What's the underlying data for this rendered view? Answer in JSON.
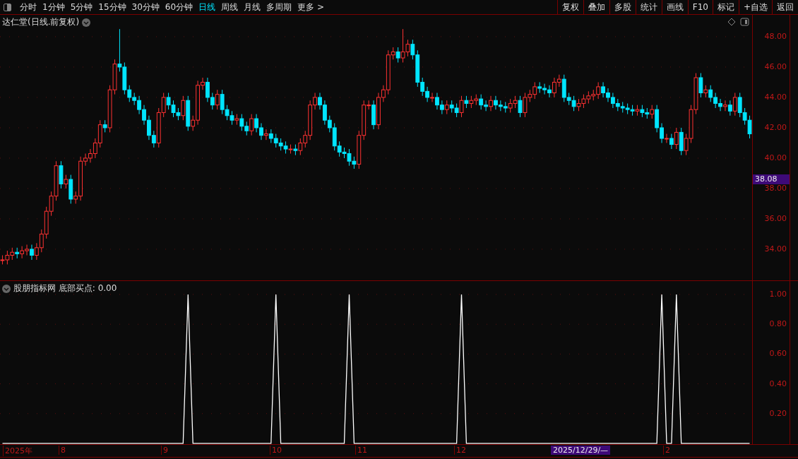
{
  "toolbar": {
    "period_tabs": [
      {
        "label": "分时",
        "selected": false
      },
      {
        "label": "1分钟",
        "selected": false
      },
      {
        "label": "5分钟",
        "selected": false
      },
      {
        "label": "15分钟",
        "selected": false
      },
      {
        "label": "30分钟",
        "selected": false
      },
      {
        "label": "60分钟",
        "selected": false
      },
      {
        "label": "日线",
        "selected": true
      },
      {
        "label": "周线",
        "selected": false
      },
      {
        "label": "月线",
        "selected": false
      },
      {
        "label": "多周期",
        "selected": false
      },
      {
        "label": "更多 >",
        "selected": false
      }
    ],
    "buttons": [
      "复权",
      "叠加",
      "多股",
      "统计",
      "画线",
      "F10",
      "标记",
      "+自选",
      "返回"
    ]
  },
  "main_chart": {
    "title": "达仁堂(日线.前复权)",
    "cursor_price": "38.08",
    "chart_data": {
      "type": "candlestick",
      "grid": true,
      "ylim": [
        31.95,
        49.44
      ],
      "yticks": [
        {
          "value": 48,
          "label": "48.00"
        },
        {
          "value": 46,
          "label": "46.00"
        },
        {
          "value": 44,
          "label": "44.00"
        },
        {
          "value": 42,
          "label": "42.00"
        },
        {
          "value": 40,
          "label": "40.00"
        },
        {
          "value": 38,
          "label": "38.00"
        },
        {
          "value": 36,
          "label": "36.00"
        },
        {
          "value": 34,
          "label": "34.00"
        }
      ],
      "ohlc": [
        [
          33.3,
          33.6,
          33.0,
          33.3
        ],
        [
          33.3,
          33.9,
          33.0,
          33.6
        ],
        [
          33.6,
          34.1,
          33.3,
          33.8
        ],
        [
          33.8,
          34.1,
          33.4,
          33.7
        ],
        [
          33.7,
          34.2,
          33.4,
          33.9
        ],
        [
          33.9,
          34.3,
          33.6,
          34.0
        ],
        [
          34.0,
          34.3,
          33.3,
          33.6
        ],
        [
          33.6,
          34.4,
          33.3,
          34.1
        ],
        [
          34.1,
          35.3,
          33.8,
          35
        ],
        [
          35,
          36.8,
          34.7,
          36.5
        ],
        [
          36.5,
          37.8,
          36.2,
          37.5
        ],
        [
          37.5,
          39.8,
          37.2,
          39.5
        ],
        [
          39.5,
          39.8,
          38.0,
          38.3
        ],
        [
          38.3,
          38.9,
          38.0,
          38.6
        ],
        [
          38.6,
          38.9,
          37.0,
          37.3
        ],
        [
          37.3,
          37.8,
          37.0,
          37.5
        ],
        [
          37.5,
          40.1,
          37.2,
          39.8
        ],
        [
          39.8,
          40.3,
          39.5,
          40
        ],
        [
          40,
          40.6,
          39.7,
          40.3
        ],
        [
          40.3,
          41.3,
          40.0,
          41
        ],
        [
          41,
          42.5,
          40.7,
          42.2
        ],
        [
          42.2,
          42.5,
          41.7,
          42
        ],
        [
          42,
          44.8,
          41.7,
          44.5
        ],
        [
          44.5,
          46.5,
          44.2,
          46.2
        ],
        [
          46.2,
          48.5,
          45.7,
          46
        ],
        [
          46,
          46.3,
          44.2,
          44.5
        ],
        [
          44.5,
          44.8,
          43.7,
          44
        ],
        [
          44,
          44.3,
          43.5,
          43.8
        ],
        [
          43.8,
          44.1,
          42.9,
          43.2
        ],
        [
          43.2,
          43.5,
          42.2,
          42.5
        ],
        [
          42.5,
          42.8,
          41.2,
          41.5
        ],
        [
          41.5,
          41.8,
          40.7,
          41
        ],
        [
          41,
          43.3,
          40.7,
          43
        ],
        [
          43,
          44.3,
          42.7,
          44
        ],
        [
          44,
          44.3,
          43.2,
          43.5
        ],
        [
          43.5,
          43.8,
          42.7,
          43
        ],
        [
          43,
          43.3,
          42.5,
          42.8
        ],
        [
          42.8,
          44.1,
          42.5,
          43.8
        ],
        [
          43.8,
          44.1,
          41.8,
          42.1
        ],
        [
          42.1,
          42.8,
          41.8,
          42.5
        ],
        [
          42.5,
          45.1,
          42.2,
          44.8
        ],
        [
          44.8,
          45.3,
          44.5,
          45
        ],
        [
          45,
          45.3,
          43.7,
          44
        ],
        [
          44,
          44.3,
          43.2,
          43.5
        ],
        [
          43.5,
          44.5,
          43.2,
          44.2
        ],
        [
          44.2,
          44.5,
          42.9,
          43.2
        ],
        [
          43.2,
          43.5,
          42.5,
          42.8
        ],
        [
          42.8,
          43.1,
          42.2,
          42.5
        ],
        [
          42.5,
          42.9,
          42.2,
          42.6
        ],
        [
          42.6,
          42.9,
          41.8,
          42.1
        ],
        [
          42.1,
          42.4,
          41.5,
          41.8
        ],
        [
          41.8,
          42.9,
          41.5,
          42.6
        ],
        [
          42.6,
          42.9,
          41.7,
          42
        ],
        [
          42,
          42.3,
          41.2,
          41.5
        ],
        [
          41.5,
          41.9,
          41.2,
          41.6
        ],
        [
          41.6,
          41.9,
          41.0,
          41.3
        ],
        [
          41.3,
          41.6,
          40.7,
          41
        ],
        [
          41,
          41.3,
          40.5,
          40.8
        ],
        [
          40.8,
          41.1,
          40.3,
          40.6
        ],
        [
          40.6,
          40.9,
          40.3,
          40.6
        ],
        [
          40.6,
          40.9,
          40.2,
          40.5
        ],
        [
          40.5,
          41.3,
          40.2,
          41
        ],
        [
          41,
          41.8,
          40.7,
          41.5
        ],
        [
          41.5,
          43.8,
          41.2,
          43.5
        ],
        [
          43.5,
          44.3,
          43.2,
          44
        ],
        [
          44,
          44.3,
          43.2,
          43.5
        ],
        [
          43.5,
          43.8,
          42.2,
          42.5
        ],
        [
          42.5,
          42.8,
          41.7,
          42.0
        ],
        [
          42,
          42.3,
          40.5,
          40.8
        ],
        [
          40.8,
          41.1,
          40.1,
          40.4
        ],
        [
          40.4,
          40.7,
          40.0,
          40.3
        ],
        [
          40.3,
          40.6,
          39.5,
          39.8
        ],
        [
          39.8,
          40.1,
          39.3,
          39.6
        ],
        [
          39.6,
          41.8,
          39.3,
          41.5
        ],
        [
          41.5,
          43.8,
          41.2,
          43.5
        ],
        [
          43.5,
          43.8,
          43.2,
          43.5
        ],
        [
          43.5,
          43.8,
          41.9,
          42.2
        ],
        [
          42.2,
          44.3,
          41.9,
          44
        ],
        [
          44,
          44.8,
          43.7,
          44.5
        ],
        [
          44.5,
          47.1,
          44.2,
          46.8
        ],
        [
          46.8,
          47.3,
          46.5,
          47
        ],
        [
          47,
          47.3,
          46.3,
          46.6
        ],
        [
          46.6,
          48.5,
          46.3,
          47
        ],
        [
          47,
          47.8,
          46.7,
          47.5
        ],
        [
          47.5,
          47.8,
          46.5,
          46.8
        ],
        [
          46.8,
          47.1,
          44.7,
          45
        ],
        [
          45,
          45.3,
          44.1,
          44.4
        ],
        [
          44.4,
          44.7,
          43.7,
          44
        ],
        [
          44,
          44.3,
          43.7,
          44
        ],
        [
          44,
          44.3,
          43.2,
          43.5
        ],
        [
          43.5,
          43.8,
          42.9,
          43.2
        ],
        [
          43.2,
          43.8,
          42.9,
          43.5
        ],
        [
          43.5,
          43.8,
          43.0,
          43.3
        ],
        [
          43.3,
          43.6,
          42.7,
          43.0
        ],
        [
          43.0,
          44.1,
          42.7,
          43.8
        ],
        [
          43.8,
          44.1,
          43.3,
          43.6
        ],
        [
          43.6,
          44.1,
          43.3,
          43.8
        ],
        [
          43.8,
          44.2,
          43.5,
          43.9
        ],
        [
          43.9,
          44.2,
          43.2,
          43.5
        ],
        [
          43.5,
          43.8,
          43.1,
          43.4
        ],
        [
          43.4,
          44.1,
          43.1,
          43.8
        ],
        [
          43.8,
          44.1,
          43.2,
          43.5
        ],
        [
          43.5,
          43.8,
          43.1,
          43.4
        ],
        [
          43.4,
          43.7,
          43.0,
          43.3
        ],
        [
          43.3,
          43.9,
          43.0,
          43.6
        ],
        [
          43.6,
          44.1,
          43.3,
          43.8
        ],
        [
          43.8,
          44.1,
          42.7,
          43
        ],
        [
          43,
          44.3,
          42.7,
          44
        ],
        [
          44,
          44.5,
          43.7,
          44.2
        ],
        [
          44.2,
          45.0,
          43.9,
          44.7
        ],
        [
          44.7,
          45.0,
          44.3,
          44.6
        ],
        [
          44.6,
          44.9,
          44.2,
          44.5
        ],
        [
          44.5,
          44.8,
          44.0,
          44.3
        ],
        [
          44.3,
          45.3,
          44.0,
          45.0
        ],
        [
          45.0,
          45.5,
          44.7,
          45.2
        ],
        [
          45.2,
          45.5,
          43.7,
          44.0
        ],
        [
          44.0,
          44.3,
          43.5,
          43.8
        ],
        [
          43.8,
          44.1,
          43.1,
          43.4
        ],
        [
          43.4,
          43.9,
          43.1,
          43.6
        ],
        [
          43.6,
          44.2,
          43.3,
          43.9
        ],
        [
          43.9,
          44.4,
          43.6,
          44.1
        ],
        [
          44.1,
          44.5,
          43.8,
          44.2
        ],
        [
          44.2,
          45.0,
          43.9,
          44.7
        ],
        [
          44.7,
          45.0,
          44.0,
          44.3
        ],
        [
          44.3,
          44.6,
          43.7,
          44.0
        ],
        [
          44.0,
          44.3,
          43.3,
          43.6
        ],
        [
          43.6,
          43.9,
          43.1,
          43.4
        ],
        [
          43.4,
          43.7,
          43.0,
          43.3
        ],
        [
          43.3,
          43.6,
          42.9,
          43.2
        ],
        [
          43.2,
          43.5,
          42.8,
          43.1
        ],
        [
          43.1,
          43.5,
          42.8,
          43.2
        ],
        [
          43.2,
          43.5,
          42.7,
          43.0
        ],
        [
          43.0,
          43.3,
          42.6,
          42.9
        ],
        [
          42.9,
          43.5,
          42.6,
          43.2
        ],
        [
          43.2,
          43.5,
          41.7,
          42.0
        ],
        [
          42.0,
          42.3,
          41.0,
          41.3
        ],
        [
          41.3,
          41.6,
          41.0,
          41.3
        ],
        [
          41.3,
          41.6,
          40.6,
          40.9
        ],
        [
          40.9,
          42.0,
          40.6,
          41.7
        ],
        [
          41.7,
          42.0,
          40.2,
          40.5
        ],
        [
          40.5,
          41.6,
          40.2,
          41.3
        ],
        [
          41.3,
          43.5,
          41.0,
          43.2
        ],
        [
          43.2,
          45.6,
          42.9,
          45.3
        ],
        [
          45.3,
          45.6,
          44.0,
          44.3
        ],
        [
          44.3,
          44.8,
          44.0,
          44.5
        ],
        [
          44.5,
          44.8,
          43.7,
          44.0
        ],
        [
          44.0,
          44.3,
          43.3,
          43.6
        ],
        [
          43.6,
          43.9,
          43.1,
          43.4
        ],
        [
          43.4,
          43.8,
          43.1,
          43.5
        ],
        [
          43.5,
          43.8,
          42.8,
          43.1
        ],
        [
          43.1,
          44.3,
          42.8,
          44.0
        ],
        [
          44.0,
          44.3,
          42.7,
          43.0
        ],
        [
          43.0,
          43.3,
          42.2,
          42.5
        ],
        [
          42.5,
          42.8,
          41.3,
          41.6
        ]
      ]
    }
  },
  "indicator_chart": {
    "title": "股朋指标网 底部买点: 0.00",
    "chart_data": {
      "type": "line",
      "grid": true,
      "ylim": [
        -0.005,
        1.09
      ],
      "yticks": [
        {
          "value": 1,
          "label": "1.00"
        },
        {
          "value": 0.8,
          "label": "0.80"
        },
        {
          "value": 0.6,
          "label": "0.60"
        },
        {
          "value": 0.4,
          "label": "0.40"
        },
        {
          "value": 0.2,
          "label": "0.20"
        }
      ],
      "categories": [
        null,
        null,
        null,
        null,
        null,
        null,
        null,
        null,
        null,
        null,
        null,
        null,
        null,
        null,
        null,
        null,
        null,
        null,
        null,
        null,
        null,
        null,
        null,
        null,
        null,
        null,
        null,
        null,
        null,
        null,
        null,
        null,
        null,
        null,
        null,
        null,
        null,
        null,
        null,
        null,
        null,
        null,
        null,
        null,
        null,
        null,
        null,
        null,
        null,
        null,
        null,
        null,
        null,
        null,
        null,
        null,
        null,
        null,
        null,
        null,
        null,
        null,
        null,
        null,
        null,
        null,
        null,
        null,
        null,
        null,
        null,
        null,
        null,
        null,
        null,
        null,
        null,
        null,
        null,
        null,
        null,
        null,
        null,
        null,
        null,
        null,
        null,
        null,
        null,
        null,
        null,
        null,
        null,
        null,
        null,
        null,
        null,
        null,
        null,
        null,
        null,
        null,
        null,
        null,
        null,
        null,
        null,
        null,
        null,
        null,
        null,
        null,
        null,
        null,
        null,
        null,
        null,
        null,
        null,
        null,
        null,
        null,
        null,
        null,
        null,
        null,
        null,
        null,
        null,
        null,
        null,
        null,
        null,
        null,
        null,
        null,
        null,
        null,
        null,
        null,
        null,
        null,
        null,
        null,
        null,
        null,
        null,
        null,
        null,
        null,
        null,
        null,
        null,
        null
      ],
      "series": [
        {
          "color": "#ffffff",
          "values": [
            0,
            0,
            0,
            0,
            0,
            0,
            0,
            0,
            0,
            0,
            0,
            0,
            0,
            0,
            0,
            0,
            0,
            0,
            0,
            0,
            0,
            0,
            0,
            0,
            0,
            0,
            0,
            0,
            0,
            0,
            0,
            0,
            0,
            0,
            0,
            0,
            0,
            0,
            1,
            0,
            0,
            0,
            0,
            0,
            0,
            0,
            0,
            0,
            0,
            0,
            0,
            0,
            0,
            0,
            0,
            0,
            1,
            0,
            0,
            0,
            0,
            0,
            0,
            0,
            0,
            0,
            0,
            0,
            0,
            0,
            0,
            1,
            0,
            0,
            0,
            0,
            0,
            0,
            0,
            0,
            0,
            0,
            0,
            0,
            0,
            0,
            0,
            0,
            0,
            0,
            0,
            0,
            0,
            0,
            1,
            0,
            0,
            0,
            0,
            0,
            0,
            0,
            0,
            0,
            0,
            0,
            0,
            0,
            0,
            0,
            0,
            0,
            0,
            0,
            0,
            0,
            0,
            0,
            0,
            0,
            0,
            0,
            0,
            0,
            0,
            0,
            0,
            0,
            0,
            0,
            0,
            0,
            0,
            0,
            0,
            1,
            0,
            0,
            1,
            0,
            0,
            0,
            0,
            0,
            0,
            0,
            0,
            0,
            0,
            0,
            0,
            0,
            0,
            0
          ]
        }
      ]
    }
  },
  "date_axis": {
    "labels": [
      "2025年",
      "8",
      "9",
      "10",
      "11",
      "12",
      "2"
    ],
    "cursor_date": "2025/12/29/—"
  }
}
